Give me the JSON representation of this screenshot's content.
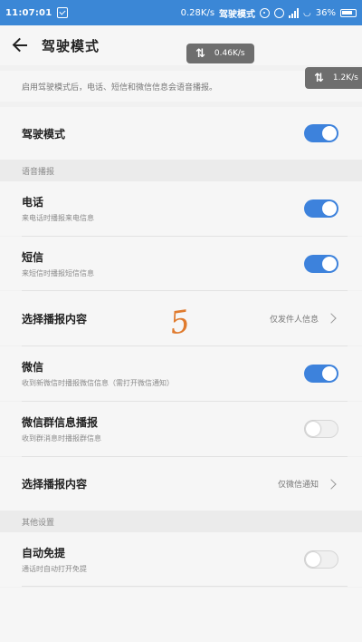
{
  "status_bar": {
    "time": "11:07:01",
    "speed": "0.28K/s",
    "mode": "驾驶模式",
    "battery": "36%"
  },
  "header": {
    "title": "驾驶模式"
  },
  "speed_overlays": [
    "0.46K/s",
    "1.2K/s"
  ],
  "description": "启用驾驶模式后，电话、短信和微信信息会语音播报。",
  "driving_mode": {
    "label": "驾驶模式",
    "enabled": true
  },
  "section_voice": "语音播报",
  "rows": [
    {
      "label": "电话",
      "sub": "来电话时播报来电信息",
      "enabled": true
    },
    {
      "label": "短信",
      "sub": "来短信时播报短信信息",
      "enabled": true
    },
    {
      "label": "选择播报内容",
      "value": "仅发件人信息"
    },
    {
      "label": "微信",
      "sub": "收到新微信时播报微信信息（需打开微信通知）",
      "enabled": true
    },
    {
      "label": "微信群信息播报",
      "sub": "收到群消息时播报群信息",
      "enabled": false
    },
    {
      "label": "选择播报内容",
      "value": "仅微信通知"
    }
  ],
  "section_other": "其他设置",
  "auto_reply": {
    "label": "自动免提",
    "sub": "通话时自动打开免提",
    "enabled": false
  },
  "overlay_mark": "5",
  "colors": {
    "accent": "#3d82dc",
    "status_bar": "#3b87d6",
    "overlay_mark": "#e07b2e"
  }
}
